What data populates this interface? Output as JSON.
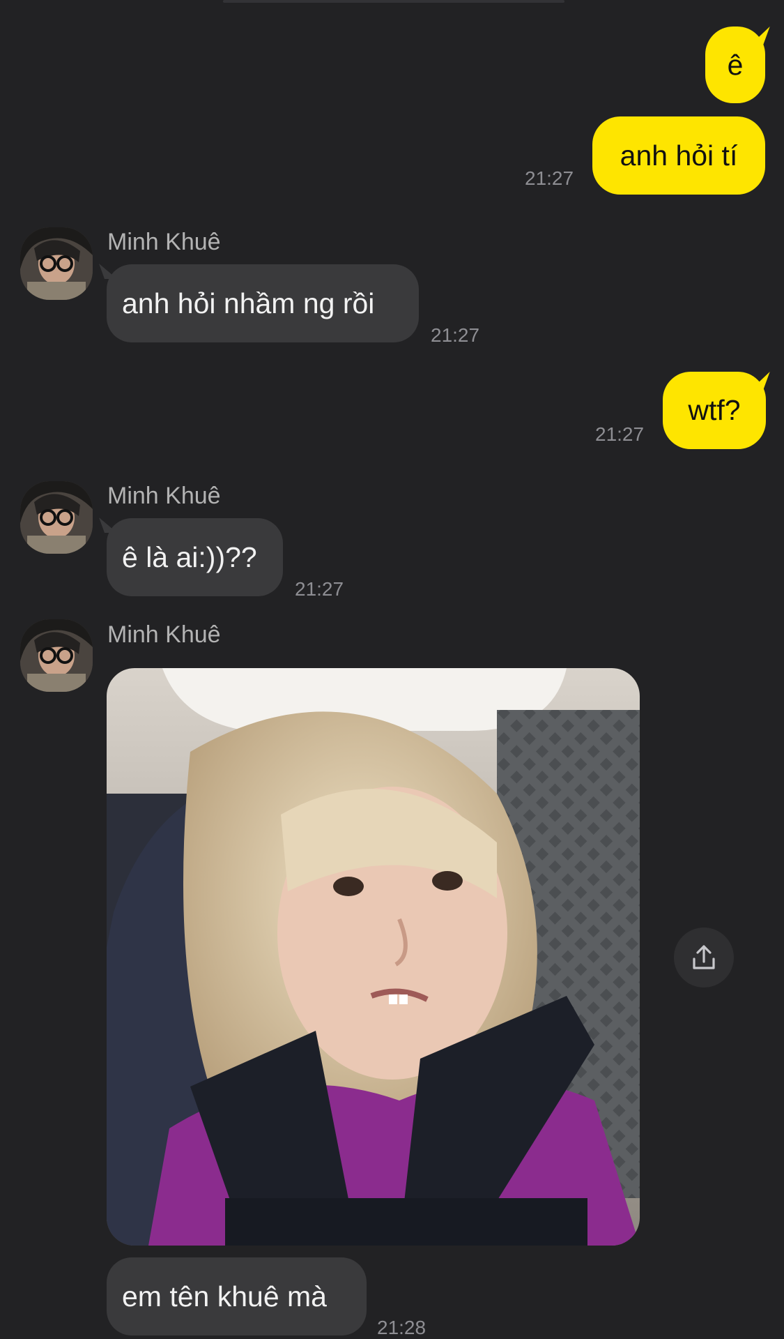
{
  "contact": {
    "name": "Minh Khuê"
  },
  "messages": [
    {
      "side": "outgoing",
      "text": "ê"
    },
    {
      "side": "outgoing",
      "text": "anh hỏi tí",
      "time": "21:27"
    },
    {
      "side": "incoming",
      "sender": "Minh Khuê",
      "text": "anh hỏi nhầm ng rồi",
      "time": "21:27"
    },
    {
      "side": "outgoing",
      "text": "wtf?",
      "time": "21:27"
    },
    {
      "side": "incoming",
      "sender": "Minh Khuê",
      "text": "ê là ai:))??",
      "time": "21:27"
    },
    {
      "side": "incoming",
      "sender": "Minh Khuê",
      "type": "image",
      "image_icon": "photo-meme-confused-girl"
    },
    {
      "side": "incoming",
      "text": "em tên khuê mà",
      "time": "21:28"
    }
  ],
  "share_icon": "share-icon",
  "colors": {
    "background": "#222224",
    "outgoing_bubble": "#fee500",
    "incoming_bubble": "#3a3a3c"
  }
}
